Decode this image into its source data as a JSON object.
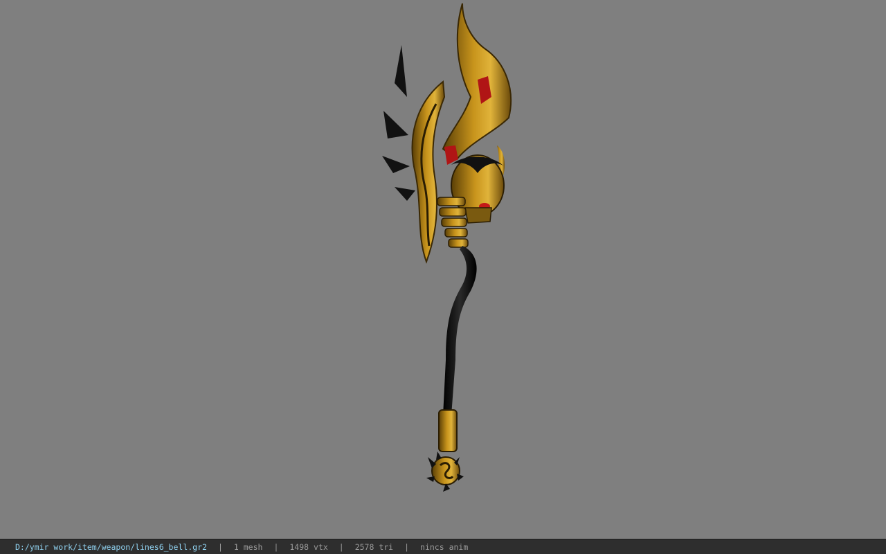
{
  "viewer": {
    "background_color": "#7f7f7f",
    "model_icon": "bell-axe-weapon-model"
  },
  "status_bar": {
    "file_path": "D:/ymir work/item/weapon/lines6_bell.gr2",
    "separator": "|",
    "mesh_count": "1 mesh",
    "vertex_count": "1498 vtx",
    "triangle_count": "2578 tri",
    "anim_status": "nincs anim",
    "path_color": "#8fd0ee",
    "text_color": "#9a9a9a"
  }
}
